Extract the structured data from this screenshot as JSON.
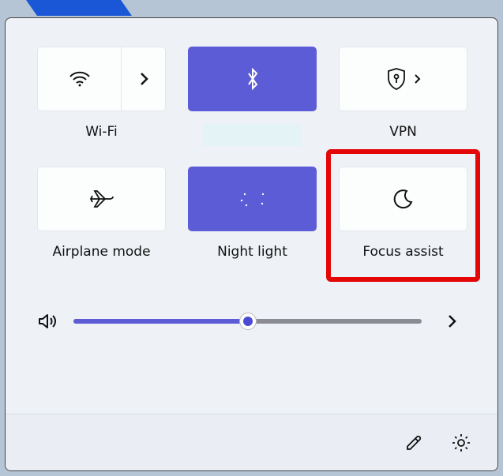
{
  "tiles": {
    "wifi": {
      "label": "Wi-Fi",
      "active": false,
      "has_expand": true
    },
    "bluetooth": {
      "label": "",
      "active": true
    },
    "vpn": {
      "label": "VPN",
      "active": false,
      "has_inline_chevron": true
    },
    "airplane": {
      "label": "Airplane mode",
      "active": false
    },
    "nightlight": {
      "label": "Night light",
      "active": true
    },
    "focus": {
      "label": "Focus assist",
      "active": false,
      "highlighted": true
    }
  },
  "volume": {
    "value": 50,
    "max": 100
  },
  "colors": {
    "accent": "#5c5cd6",
    "highlight": "#e30707"
  }
}
